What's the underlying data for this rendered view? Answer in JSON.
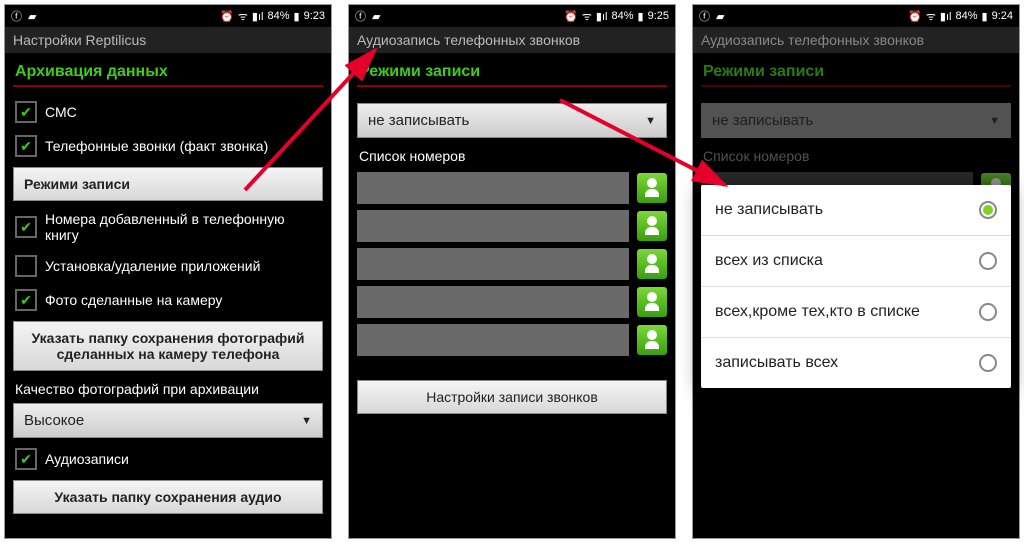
{
  "status": {
    "battery": "84%",
    "time1": "9:23",
    "time2": "9:25",
    "time3": "9:24"
  },
  "screen1": {
    "appbar": "Настройки Reptilicus",
    "section": "Архивация данных",
    "items": {
      "sms": "СМС",
      "calls": "Телефонные звонки (факт звонка)",
      "recmode": "Режими записи",
      "numbers": "Номера добавленный в телефонную книгу",
      "apps": "Установка/удаление приложений",
      "photos": "Фото сделанные на камеру",
      "photofolder": "Указать папку сохранения фотографий сделанных на камеру телефона",
      "quality_label": "Качество фотографий при архивации",
      "quality_value": "Высокое",
      "audio": "Аудиозаписи",
      "audiofolder": "Указать папку сохранения аудио"
    }
  },
  "screen2": {
    "appbar": "Аудиозапись телефонных звонков",
    "section": "Режими записи",
    "dropdown_value": "не записывать",
    "list_label": "Список номеров",
    "settings_btn": "Настройки записи звонков"
  },
  "screen3": {
    "appbar": "Аудиозапись телефонных звонков",
    "section": "Режими записи",
    "dropdown_value": "не записывать",
    "list_label": "Список номеров",
    "options": {
      "o1": "не записывать",
      "o2": "всех из списка",
      "o3": "всех,кроме тех,кто в списке",
      "o4": "записывать всех"
    }
  }
}
